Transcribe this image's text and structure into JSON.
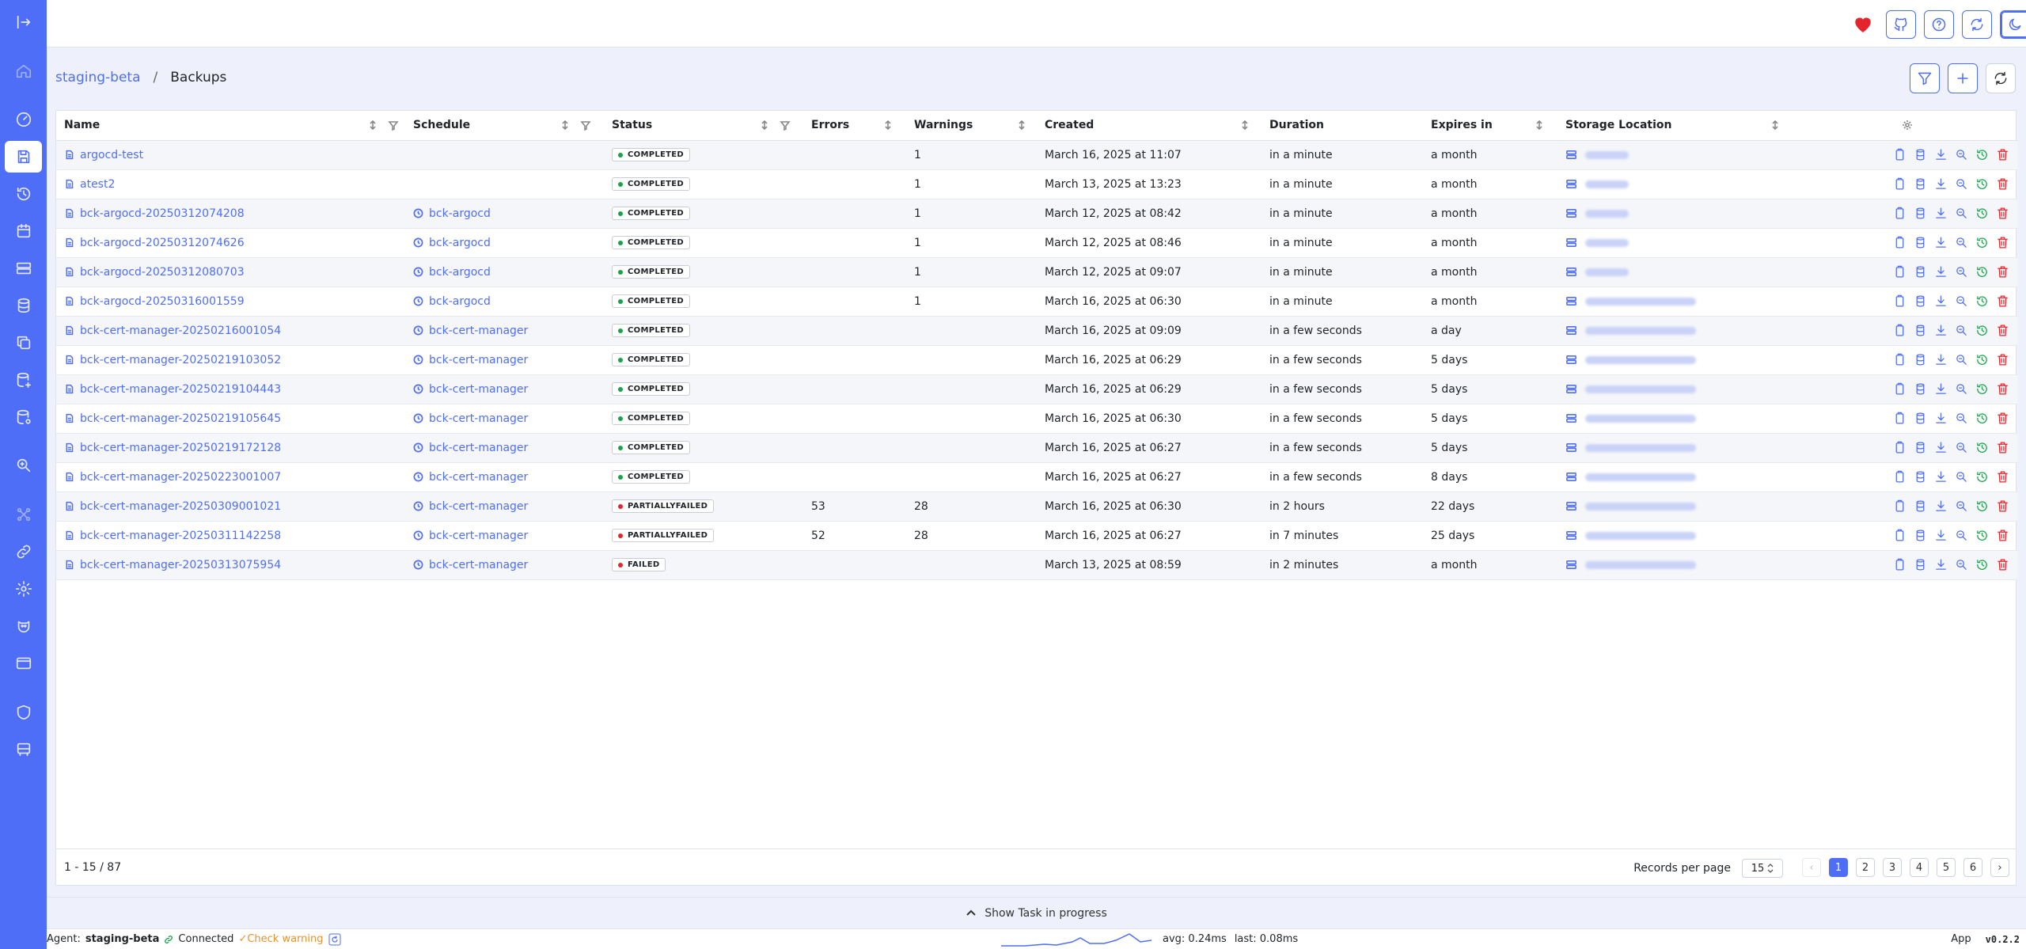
{
  "topbar": {
    "buttons": [
      "heart-icon",
      "github-icon",
      "help-icon",
      "refresh-icon",
      "moon-icon",
      "user-icon"
    ]
  },
  "breadcrumb": {
    "root": "staging-beta",
    "separator": "/",
    "current": "Backups"
  },
  "table": {
    "columns": {
      "name": "Name",
      "schedule": "Schedule",
      "status": "Status",
      "errors": "Errors",
      "warnings": "Warnings",
      "created": "Created",
      "duration": "Duration",
      "expires": "Expires in",
      "storage": "Storage Location"
    },
    "rows": [
      {
        "name": "argocd-test",
        "schedule": "",
        "status": "COMPLETED",
        "errors": "",
        "warnings": "1",
        "created": "March 16, 2025 at 11:07",
        "duration": "in a minute",
        "expires": "a month",
        "storage_width": "short"
      },
      {
        "name": "atest2",
        "schedule": "",
        "status": "COMPLETED",
        "errors": "",
        "warnings": "1",
        "created": "March 13, 2025 at 13:23",
        "duration": "in a minute",
        "expires": "a month",
        "storage_width": "short"
      },
      {
        "name": "bck-argocd-20250312074208",
        "schedule": "bck-argocd",
        "status": "COMPLETED",
        "errors": "",
        "warnings": "1",
        "created": "March 12, 2025 at 08:42",
        "duration": "in a minute",
        "expires": "a month",
        "storage_width": "short"
      },
      {
        "name": "bck-argocd-20250312074626",
        "schedule": "bck-argocd",
        "status": "COMPLETED",
        "errors": "",
        "warnings": "1",
        "created": "March 12, 2025 at 08:46",
        "duration": "in a minute",
        "expires": "a month",
        "storage_width": "short"
      },
      {
        "name": "bck-argocd-20250312080703",
        "schedule": "bck-argocd",
        "status": "COMPLETED",
        "errors": "",
        "warnings": "1",
        "created": "March 12, 2025 at 09:07",
        "duration": "in a minute",
        "expires": "a month",
        "storage_width": "short"
      },
      {
        "name": "bck-argocd-20250316001559",
        "schedule": "bck-argocd",
        "status": "COMPLETED",
        "errors": "",
        "warnings": "1",
        "created": "March 16, 2025 at 06:30",
        "duration": "in a minute",
        "expires": "a month",
        "storage_width": "long"
      },
      {
        "name": "bck-cert-manager-20250216001054",
        "schedule": "bck-cert-manager",
        "status": "COMPLETED",
        "errors": "",
        "warnings": "",
        "created": "March 16, 2025 at 09:09",
        "duration": "in a few seconds",
        "expires": "a day",
        "storage_width": "long"
      },
      {
        "name": "bck-cert-manager-20250219103052",
        "schedule": "bck-cert-manager",
        "status": "COMPLETED",
        "errors": "",
        "warnings": "",
        "created": "March 16, 2025 at 06:29",
        "duration": "in a few seconds",
        "expires": "5 days",
        "storage_width": "long"
      },
      {
        "name": "bck-cert-manager-20250219104443",
        "schedule": "bck-cert-manager",
        "status": "COMPLETED",
        "errors": "",
        "warnings": "",
        "created": "March 16, 2025 at 06:29",
        "duration": "in a few seconds",
        "expires": "5 days",
        "storage_width": "long"
      },
      {
        "name": "bck-cert-manager-20250219105645",
        "schedule": "bck-cert-manager",
        "status": "COMPLETED",
        "errors": "",
        "warnings": "",
        "created": "March 16, 2025 at 06:30",
        "duration": "in a few seconds",
        "expires": "5 days",
        "storage_width": "long"
      },
      {
        "name": "bck-cert-manager-20250219172128",
        "schedule": "bck-cert-manager",
        "status": "COMPLETED",
        "errors": "",
        "warnings": "",
        "created": "March 16, 2025 at 06:27",
        "duration": "in a few seconds",
        "expires": "5 days",
        "storage_width": "long"
      },
      {
        "name": "bck-cert-manager-20250223001007",
        "schedule": "bck-cert-manager",
        "status": "COMPLETED",
        "errors": "",
        "warnings": "",
        "created": "March 16, 2025 at 06:27",
        "duration": "in a few seconds",
        "expires": "8 days",
        "storage_width": "long"
      },
      {
        "name": "bck-cert-manager-20250309001021",
        "schedule": "bck-cert-manager",
        "status": "PARTIALLYFAILED",
        "errors": "53",
        "warnings": "28",
        "created": "March 16, 2025 at 06:30",
        "duration": "in 2 hours",
        "expires": "22 days",
        "storage_width": "long"
      },
      {
        "name": "bck-cert-manager-20250311142258",
        "schedule": "bck-cert-manager",
        "status": "PARTIALLYFAILED",
        "errors": "52",
        "warnings": "28",
        "created": "March 16, 2025 at 06:27",
        "duration": "in 7 minutes",
        "expires": "25 days",
        "storage_width": "long"
      },
      {
        "name": "bck-cert-manager-20250313075954",
        "schedule": "bck-cert-manager",
        "status": "FAILED",
        "errors": "",
        "warnings": "",
        "created": "March 13, 2025 at 08:59",
        "duration": "in 2 minutes",
        "expires": "a month",
        "storage_width": "long"
      }
    ],
    "status_colors": {
      "COMPLETED": "#18a34a",
      "PARTIALLYFAILED": "#e5242c",
      "FAILED": "#e5242c"
    }
  },
  "footer": {
    "range": "1 - 15 / 87",
    "records_label": "Records per page",
    "records_value": "15",
    "pages": [
      "1",
      "2",
      "3",
      "4",
      "5",
      "6"
    ],
    "prev": "‹",
    "next": "›"
  },
  "taskbar": {
    "label": "Show Task in progress"
  },
  "statusbar": {
    "agent_label": "Agent:",
    "agent_name": "staging-beta",
    "connected": "Connected",
    "check_warning": "Check warning",
    "avg": "avg: 0.24ms",
    "last": "last: 0.08ms",
    "app": "App",
    "version": "v0.2.2"
  },
  "colors": {
    "accent": "#4f6ef7",
    "success": "#18a34a",
    "danger": "#e5242c",
    "warning": "#e8912d"
  }
}
